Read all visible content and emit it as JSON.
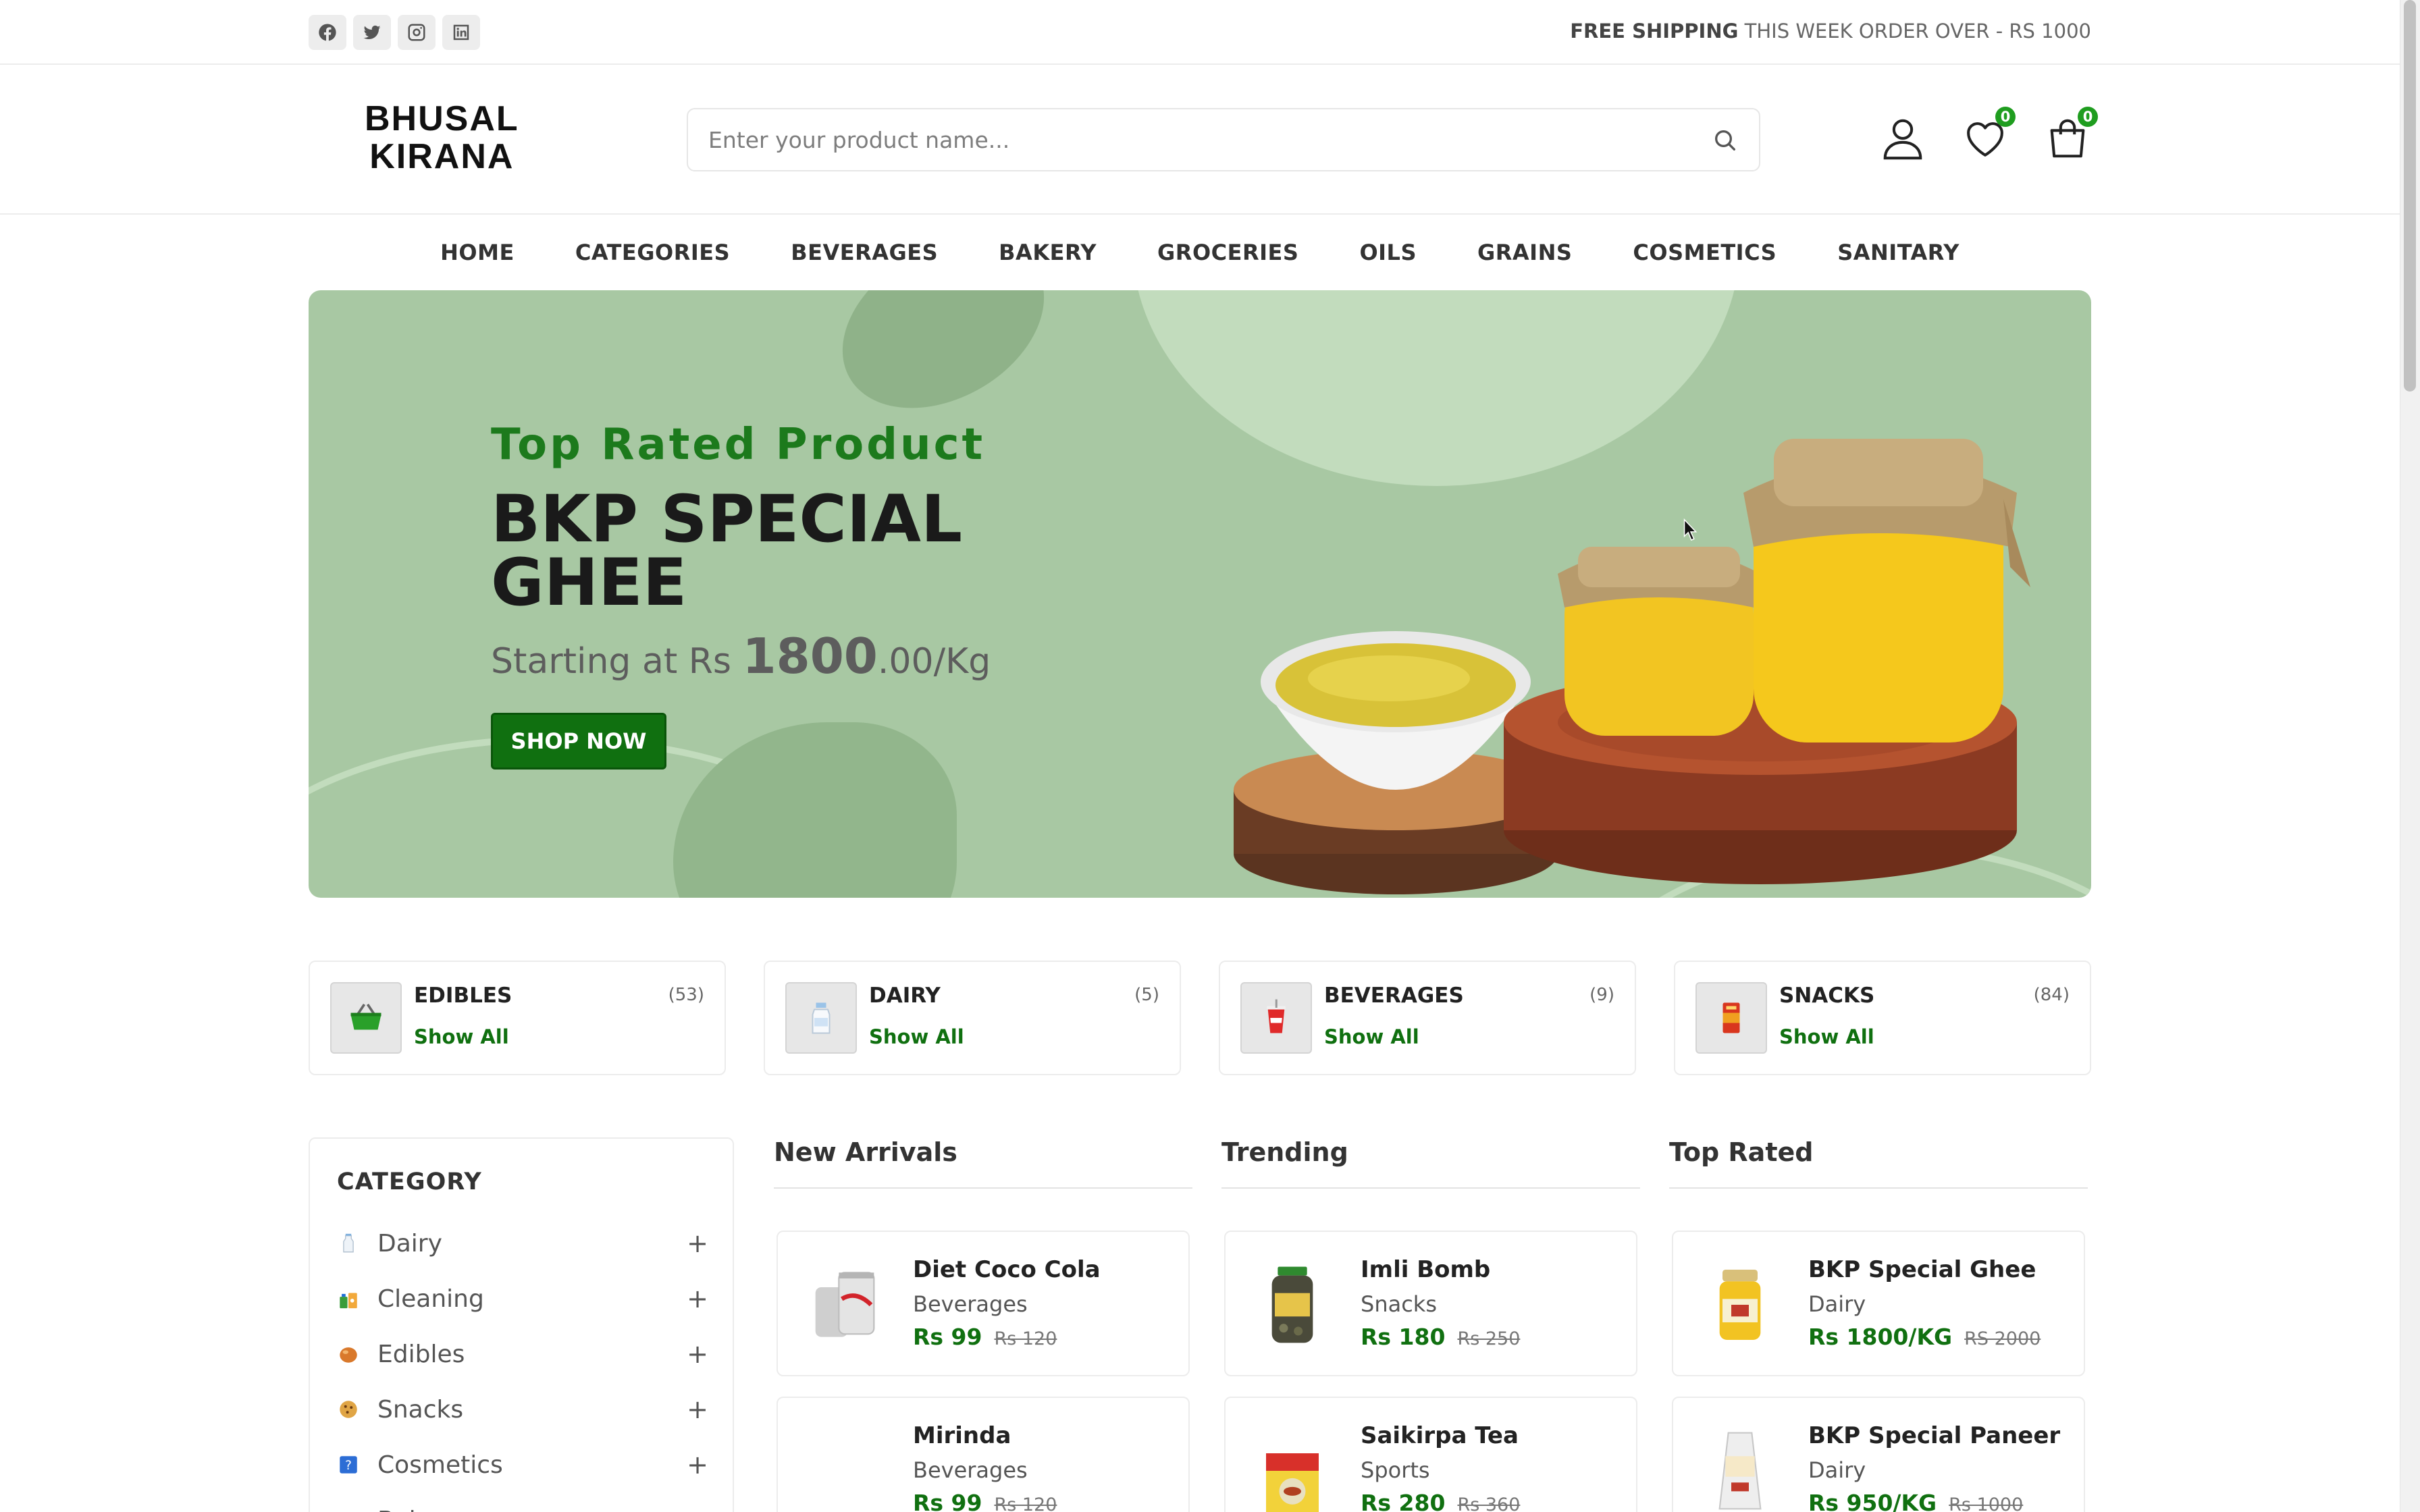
{
  "topbar": {
    "socials": [
      {
        "icon": "facebook-icon"
      },
      {
        "icon": "twitter-icon"
      },
      {
        "icon": "instagram-icon"
      },
      {
        "icon": "linkedin-icon"
      }
    ],
    "promo_bold": "FREE SHIPPING",
    "promo_rest": " THIS WEEK ORDER OVER - RS 1000"
  },
  "header": {
    "logo_line1": "BHUSAL",
    "logo_line2": "KIRANA",
    "search_placeholder": "Enter your product name...",
    "wishlist_count": "0",
    "cart_count": "0"
  },
  "nav": [
    "HOME",
    "CATEGORIES",
    "BEVERAGES",
    "BAKERY",
    "GROCERIES",
    "OILS",
    "GRAINS",
    "COSMETICS",
    "SANITARY"
  ],
  "hero": {
    "subtitle": "Top Rated Product",
    "title": "BKP SPECIAL GHEE",
    "price_prefix": "Starting at Rs ",
    "price_big": "1800",
    "price_suffix": ".00/Kg",
    "cta": "SHOP NOW"
  },
  "category_cards": [
    {
      "name": "EDIBLES",
      "count": "(53)",
      "link": "Show All",
      "icon": "basket-icon"
    },
    {
      "name": "DAIRY",
      "count": "(5)",
      "link": "Show All",
      "icon": "milk-bottle-icon"
    },
    {
      "name": "BEVERAGES",
      "count": "(9)",
      "link": "Show All",
      "icon": "soda-cup-icon"
    },
    {
      "name": "SNACKS",
      "count": "(84)",
      "link": "Show All",
      "icon": "snack-pack-icon"
    }
  ],
  "sidebar": {
    "title": "CATEGORY",
    "items": [
      {
        "label": "Dairy",
        "icon": "milk-bottle-icon"
      },
      {
        "label": "Cleaning",
        "icon": "cleaning-icon"
      },
      {
        "label": "Edibles",
        "icon": "bread-icon"
      },
      {
        "label": "Snacks",
        "icon": "cookie-icon"
      },
      {
        "label": "Cosmetics",
        "icon": "cosmetics-icon"
      },
      {
        "label": "Bakery",
        "icon": "bakery-icon"
      }
    ]
  },
  "columns": [
    {
      "title": "New Arrivals",
      "products": [
        {
          "name": "Diet Coco Cola",
          "category": "Beverages",
          "price": "Rs 99",
          "old_price": "Rs 120",
          "icon": "soda-can-icon"
        },
        {
          "name": "Mirinda",
          "category": "Beverages",
          "price": "Rs 99",
          "old_price": "Rs 120",
          "icon": "soda-bottle-icon"
        }
      ]
    },
    {
      "title": "Trending",
      "products": [
        {
          "name": "Imli Bomb",
          "category": "Snacks",
          "price": "Rs 180",
          "old_price": "Rs 250",
          "icon": "candy-jar-icon"
        },
        {
          "name": "Saikirpa Tea",
          "category": "Sports",
          "price": "Rs 280",
          "old_price": "Rs 360",
          "icon": "tea-pack-icon"
        }
      ]
    },
    {
      "title": "Top Rated",
      "products": [
        {
          "name": "BKP Special Ghee",
          "category": "Dairy",
          "price": "Rs 1800/KG",
          "old_price": "RS 2000",
          "icon": "ghee-jar-icon"
        },
        {
          "name": "BKP Special Paneer",
          "category": "Dairy",
          "price": "Rs 950/KG",
          "old_price": "Rs 1000",
          "icon": "paneer-pack-icon"
        }
      ]
    }
  ]
}
